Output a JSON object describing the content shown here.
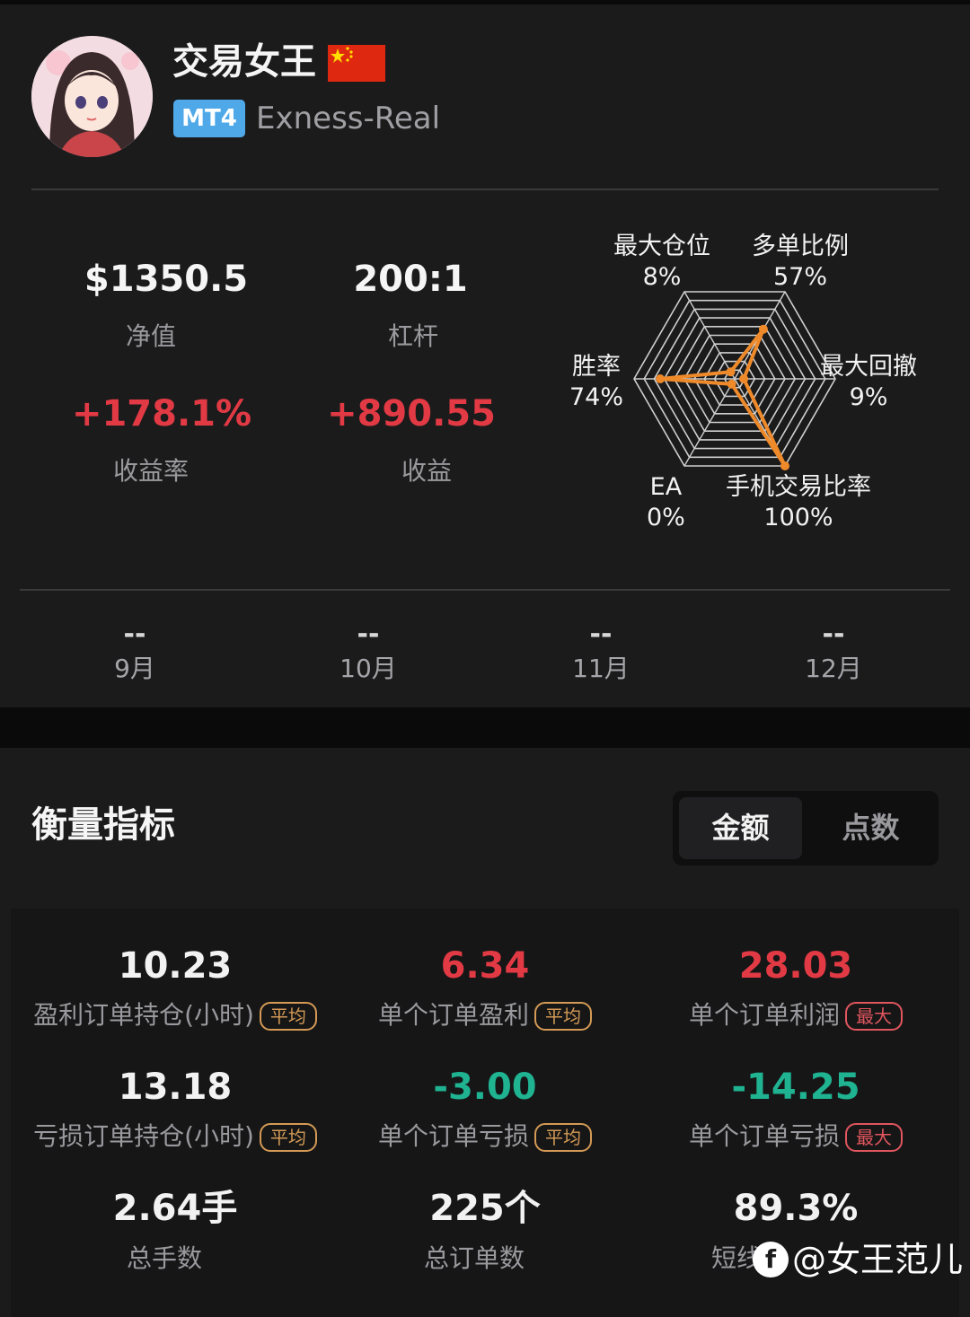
{
  "profile": {
    "name": "交易女王",
    "platform_badge": "MT4",
    "server": "Exness-Real"
  },
  "stats": {
    "equity_value": "$1350.5",
    "equity_label": "净值",
    "leverage_value": "200:1",
    "leverage_label": "杠杆",
    "return_rate_value": "+178.1%",
    "return_rate_label": "收益率",
    "profit_value": "+890.55",
    "profit_label": "收益"
  },
  "radar": {
    "axes": [
      {
        "name": "最大仓位",
        "value": "8%",
        "fraction": 0.08
      },
      {
        "name": "多单比例",
        "value": "57%",
        "fraction": 0.57
      },
      {
        "name": "最大回撤",
        "value": "9%",
        "fraction": 0.09
      },
      {
        "name": "手机交易比率",
        "value": "100%",
        "fraction": 1.0
      },
      {
        "name": "EA",
        "value": "0%",
        "fraction": 0.0
      },
      {
        "name": "胜率",
        "value": "74%",
        "fraction": 0.74
      }
    ],
    "line_color": "#ef8a2a"
  },
  "months": [
    {
      "value": "--",
      "label": "9月"
    },
    {
      "value": "--",
      "label": "10月"
    },
    {
      "value": "--",
      "label": "11月"
    },
    {
      "value": "--",
      "label": "12月"
    }
  ],
  "metrics": {
    "title": "衡量指标",
    "toggle": {
      "active": "金额",
      "inactive": "点数"
    },
    "items": [
      {
        "value": "10.23",
        "label": "盈利订单持仓(小时)",
        "tag": "平均"
      },
      {
        "value": "6.34",
        "label": "单个订单盈利",
        "tag": "平均"
      },
      {
        "value": "28.03",
        "label": "单个订单利润",
        "tag": "最大"
      },
      {
        "value": "13.18",
        "label": "亏损订单持仓(小时)",
        "tag": "平均"
      },
      {
        "value": "-3.00",
        "label": "单个订单亏损",
        "tag": "平均"
      },
      {
        "value": "-14.25",
        "label": "单个订单亏损",
        "tag": "最大"
      },
      {
        "value": "2.64手",
        "label": "总手数"
      },
      {
        "value": "225个",
        "label": "总订单数"
      },
      {
        "value": "89.3%",
        "label": "短线"
      }
    ]
  },
  "watermark": {
    "icon": "f",
    "text": "@女王范儿"
  },
  "colors": {
    "positive": "#e23a44",
    "negative": "#1fb391",
    "tag_avg": "#d49a55",
    "tag_max": "#e0565e"
  }
}
